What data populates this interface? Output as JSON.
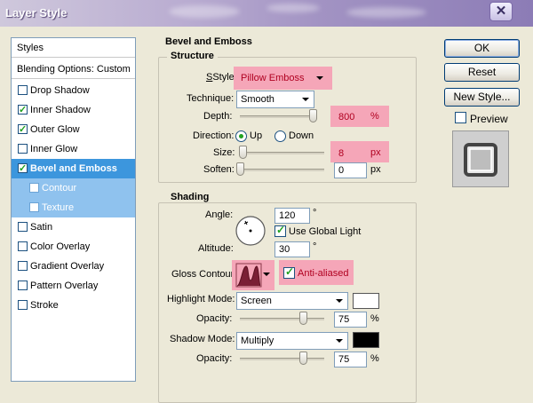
{
  "window": {
    "title": "Layer Style"
  },
  "styles_list": {
    "header": "Styles",
    "blending": "Blending Options: Custom",
    "items": [
      {
        "label": "Drop Shadow",
        "checked": false
      },
      {
        "label": "Inner Shadow",
        "checked": true
      },
      {
        "label": "Outer Glow",
        "checked": true
      },
      {
        "label": "Inner Glow",
        "checked": false
      },
      {
        "label": "Bevel and Emboss",
        "checked": true,
        "selected": true
      },
      {
        "label": "Contour",
        "checked": false,
        "sub": true
      },
      {
        "label": "Texture",
        "checked": false,
        "sub": true
      },
      {
        "label": "Satin",
        "checked": false
      },
      {
        "label": "Color Overlay",
        "checked": false
      },
      {
        "label": "Gradient Overlay",
        "checked": false
      },
      {
        "label": "Pattern Overlay",
        "checked": false
      },
      {
        "label": "Stroke",
        "checked": false
      }
    ]
  },
  "bevel": {
    "title": "Bevel and Emboss",
    "structure": {
      "title": "Structure",
      "style_label": "Style:",
      "style_value": "Pillow Emboss",
      "technique_label": "Technique:",
      "technique_value": "Smooth",
      "depth_label": "Depth:",
      "depth_value": "800",
      "depth_unit": "%",
      "depth_level": 0.96,
      "direction_label": "Direction:",
      "dir_up": "Up",
      "dir_down": "Down",
      "size_label": "Size:",
      "size_value": "8",
      "size_unit": "px",
      "size_level": 0.03,
      "soften_label": "Soften:",
      "soften_value": "0",
      "soften_unit": "px",
      "soften_level": 0.0
    },
    "shading": {
      "title": "Shading",
      "angle_label": "Angle:",
      "angle_value": "120",
      "angle_unit": "°",
      "global_light": "Use Global Light",
      "altitude_label": "Altitude:",
      "altitude_value": "30",
      "altitude_unit": "°",
      "gloss_label": "Gloss Contour:",
      "anti_aliased": "Anti-aliased",
      "highlight_label": "Highlight Mode:",
      "highlight_value": "Screen",
      "highlight_color": "#ffffff",
      "hl_opacity_label": "Opacity:",
      "hl_opacity_value": "75",
      "hl_opacity_unit": "%",
      "hl_opacity_level": 0.75,
      "shadow_label": "Shadow Mode:",
      "shadow_value": "Multiply",
      "shadow_color": "#000000",
      "sh_opacity_label": "Opacity:",
      "sh_opacity_value": "75",
      "sh_opacity_unit": "%",
      "sh_opacity_level": 0.75
    }
  },
  "buttons": {
    "ok": "OK",
    "reset": "Reset",
    "new_style": "New Style...",
    "preview": "Preview"
  },
  "colors": {
    "accent": "#3c96dd",
    "highlight_box": "#f5a6b8"
  }
}
